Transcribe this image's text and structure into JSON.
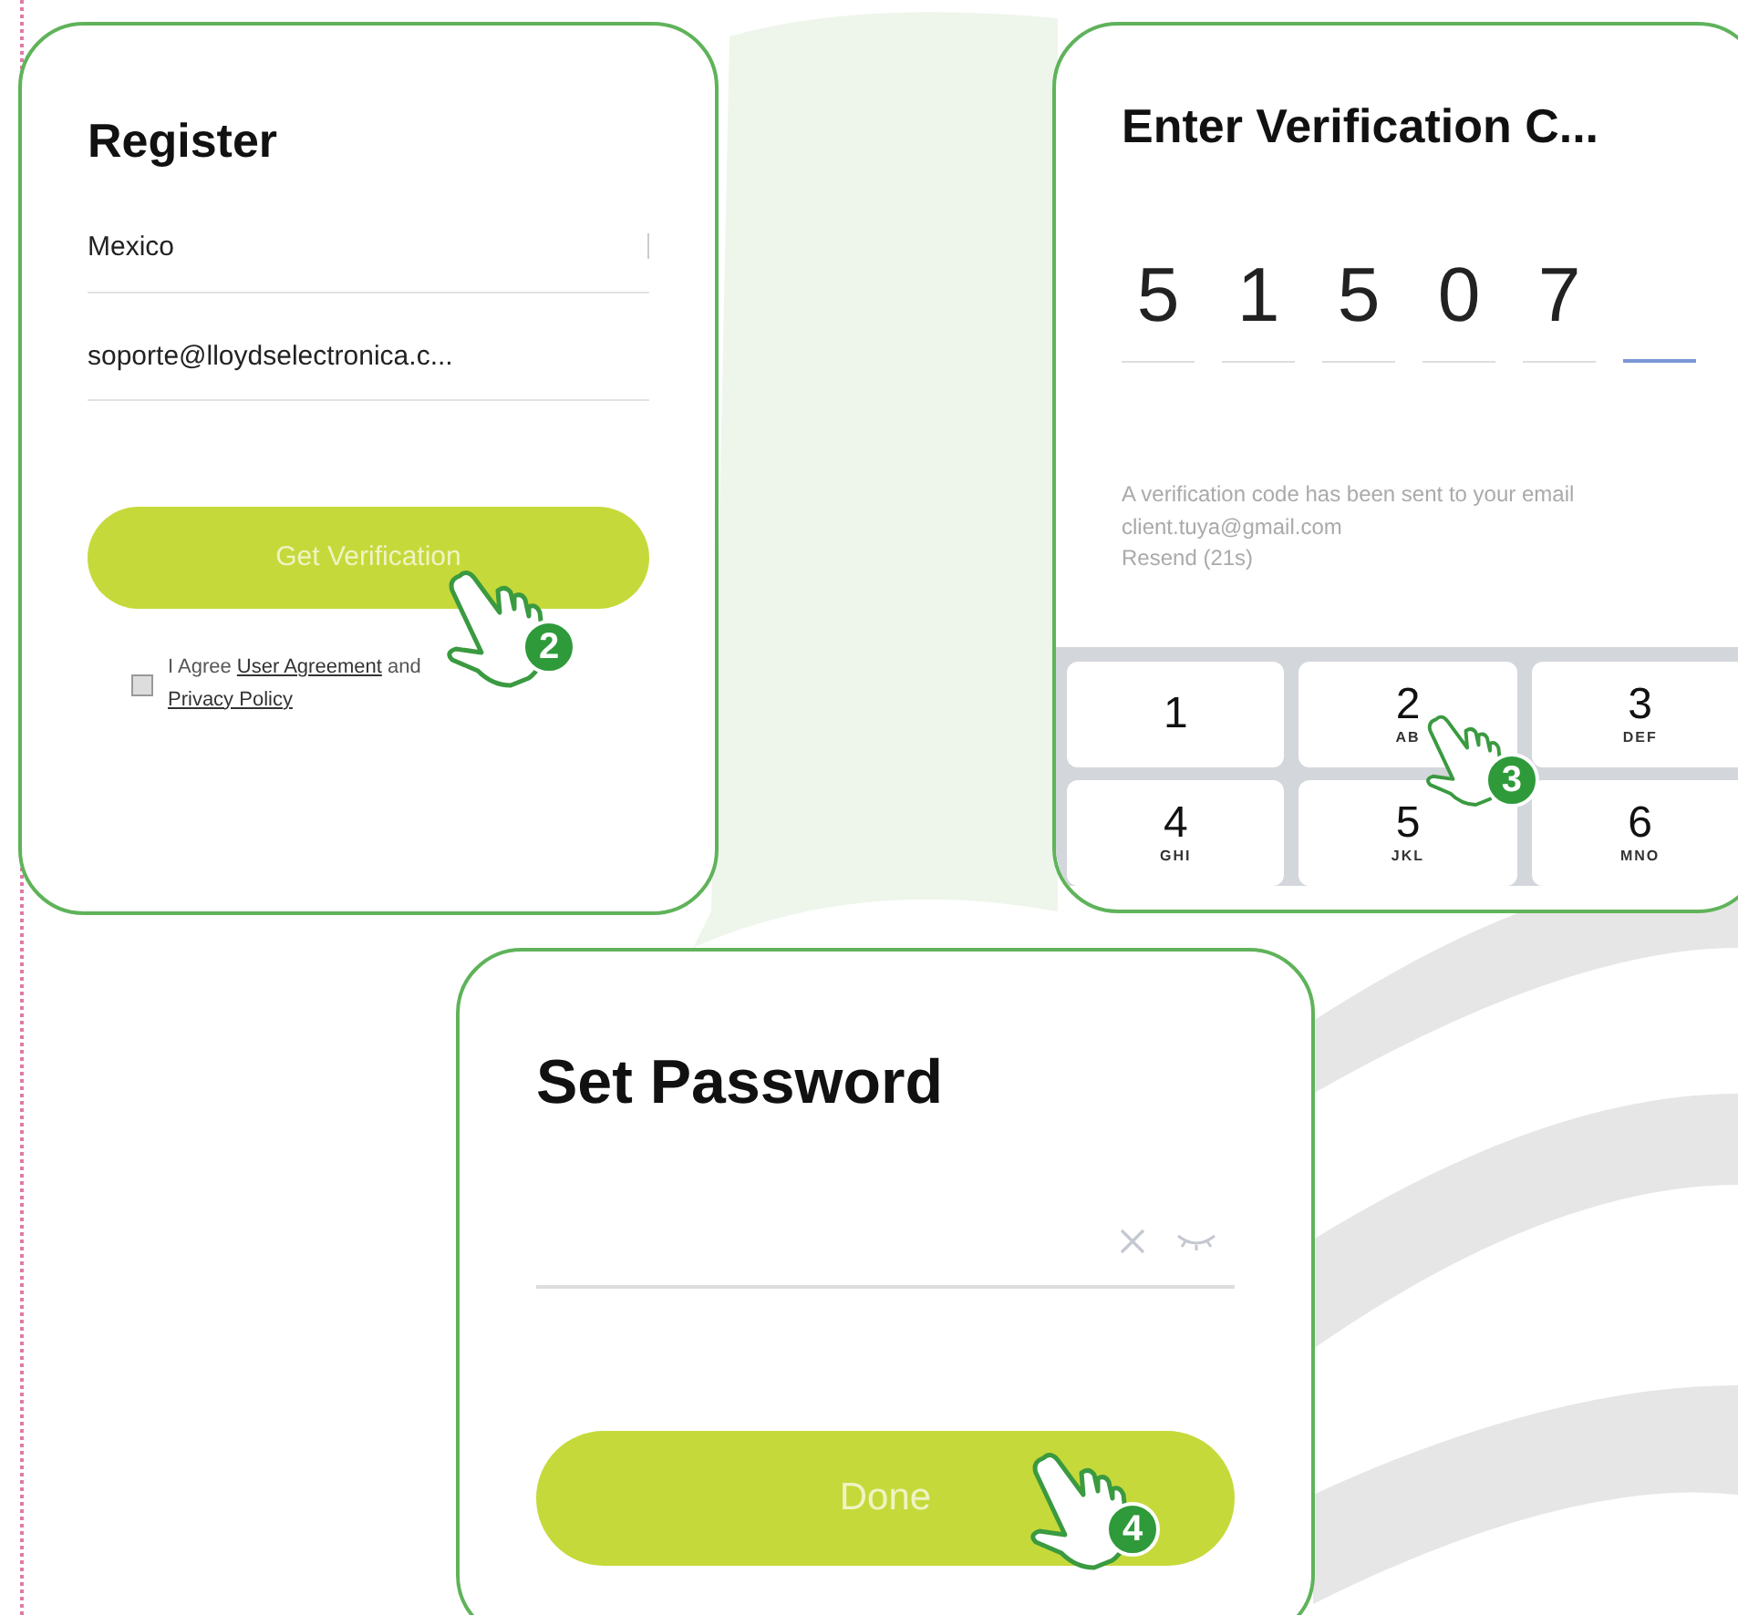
{
  "register": {
    "title": "Register",
    "country": "Mexico",
    "email": "soporte@lloydselectronica.c...",
    "button": "Get Verification",
    "step": "2",
    "agreement": {
      "checked": false,
      "parts": [
        {
          "kind": "text",
          "text": "I Agree "
        },
        {
          "kind": "link",
          "text": "User Agreement"
        },
        {
          "kind": "text",
          "text": " and "
        },
        {
          "kind": "link",
          "text": "Privacy Policy"
        }
      ]
    }
  },
  "verification": {
    "title": "Enter Verification C...",
    "slots": [
      {
        "digit": "5",
        "active": false
      },
      {
        "digit": "1",
        "active": false
      },
      {
        "digit": "5",
        "active": false
      },
      {
        "digit": "0",
        "active": false
      },
      {
        "digit": "7",
        "active": false
      },
      {
        "active": true
      }
    ],
    "message": "A verification code has been sent to your email client.tuya@gmail.com",
    "resend": "Resend (21s)",
    "step": "3",
    "keys": [
      {
        "digit": "1"
      },
      {
        "digit": "2",
        "letters": "AB"
      },
      {
        "digit": "3",
        "letters": "DEF"
      },
      {
        "digit": "4",
        "letters": "GHI"
      },
      {
        "digit": "5",
        "letters": "JKL"
      },
      {
        "digit": "6",
        "letters": "MNO"
      }
    ]
  },
  "password": {
    "title": "Set Password",
    "button": "Done",
    "step": "4"
  }
}
